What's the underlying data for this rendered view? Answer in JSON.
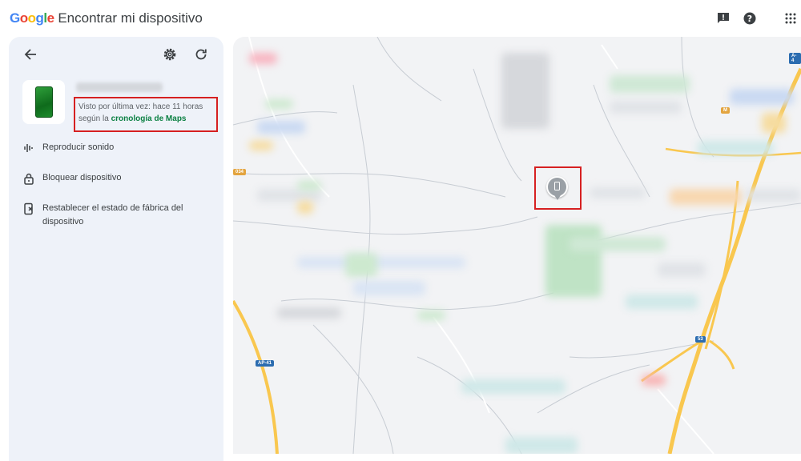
{
  "app": {
    "brand": "Google",
    "title": "Encontrar mi dispositivo"
  },
  "header_icons": [
    "feedback-icon",
    "help-icon",
    "apps-grid-icon"
  ],
  "sidebar": {
    "back_icon": "arrow-back-icon",
    "settings_icon": "gear-icon",
    "refresh_icon": "refresh-icon",
    "device": {
      "last_seen_text": "Visto por última vez: hace 11 horas",
      "source_prefix": "según la",
      "source_link": "cronología de Maps"
    },
    "actions": [
      {
        "label": "Reproducir sonido",
        "icon": "sound-wave-icon"
      },
      {
        "label": "Bloquear dispositivo",
        "icon": "lock-icon"
      },
      {
        "label": "Restablecer el estado de fábrica del dispositivo",
        "icon": "phone-erase-icon"
      }
    ]
  },
  "map": {
    "road_labels": [
      "034",
      "AP-41",
      "A-4",
      "53",
      "M"
    ],
    "pin_icon": "device-location-pin-icon"
  },
  "colors": {
    "highlight_box": "#d62021",
    "link_green": "#0b8043",
    "sidebar_bg": "#eef2f9",
    "highway_yellow": "#f9c74f"
  }
}
